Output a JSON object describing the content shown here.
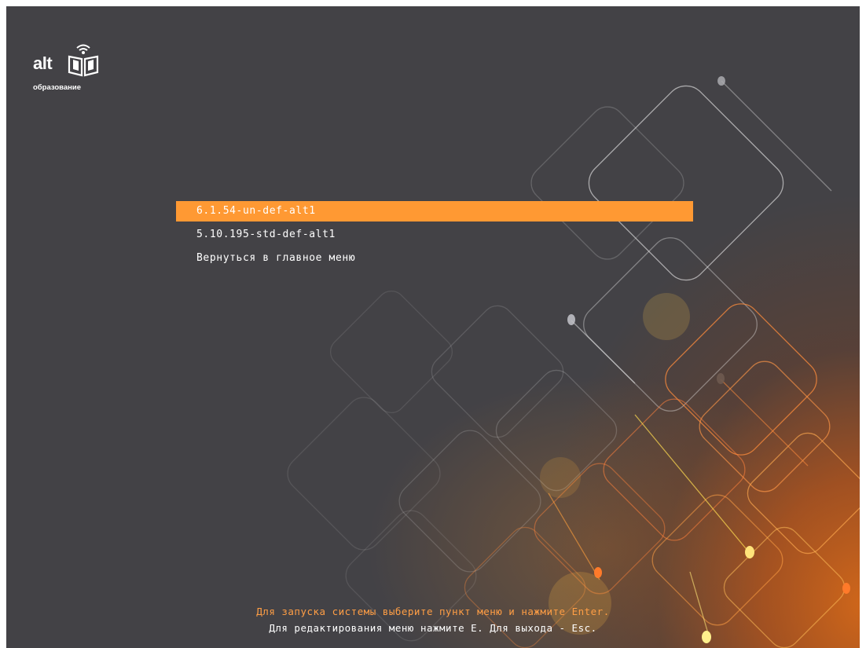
{
  "branding": {
    "logo_text": "alt",
    "logo_subtitle": "образование",
    "logo_icon": "book-wifi-icon"
  },
  "menu": {
    "items": [
      {
        "label": "6.1.54-un-def-alt1",
        "selected": true
      },
      {
        "label": "5.10.195-std-def-alt1",
        "selected": false
      },
      {
        "label": "Вернуться в главное меню",
        "selected": false
      }
    ]
  },
  "footer": {
    "line1": "Для запуска системы выберите пункт меню и нажмите Enter.",
    "line2": "Для редактирования меню нажмите E. Для выхода - Esc."
  },
  "colors": {
    "background": "#434246",
    "highlight": "#ff9933",
    "hint_text": "#ff9e45",
    "text": "#ffffff"
  }
}
